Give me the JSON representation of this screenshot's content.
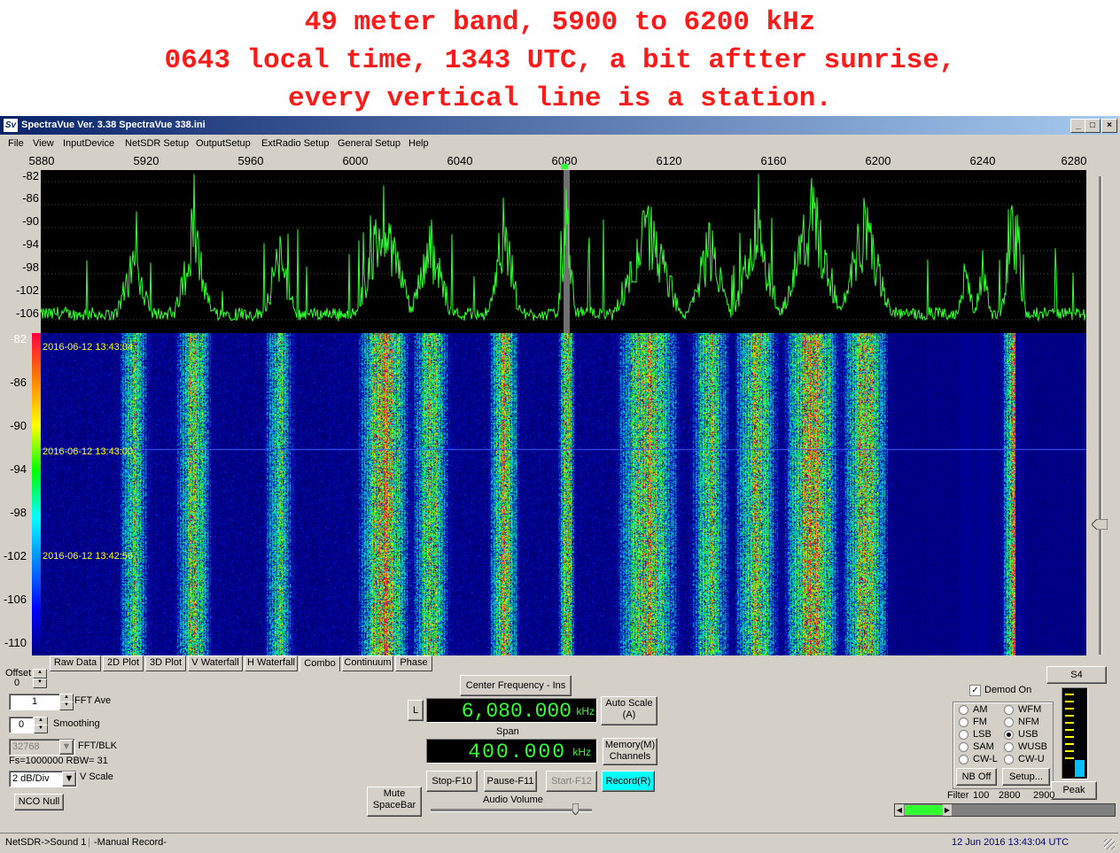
{
  "caption": {
    "line1": "49 meter band, 5900 to 6200 kHz",
    "line2": "0643 local time, 1343 UTC, a bit aftter sunrise,",
    "line3": "every vertical line is a station."
  },
  "window": {
    "title": "SpectraVue Ver. 3.38  SpectraVue 338.ini",
    "icon_text": "Sv",
    "minimize": "_",
    "maximize": "□",
    "close": "×"
  },
  "menu": [
    "File",
    "View",
    "InputDevice",
    "NetSDR Setup",
    "OutputSetup",
    "ExtRadio Setup",
    "General Setup",
    "Help"
  ],
  "freq_axis": [
    "5880",
    "5920",
    "5960",
    "6000",
    "6040",
    "6080",
    "6120",
    "6160",
    "6200",
    "6240",
    "6280"
  ],
  "spectrum_db_labels": [
    "-82",
    "-86",
    "-90",
    "-94",
    "-98",
    "-102",
    "-106"
  ],
  "waterfall_db_labels": [
    "-82",
    "-86",
    "-90",
    "-94",
    "-98",
    "-102",
    "-106",
    "-110"
  ],
  "waterfall_timestamps": [
    "2016-06-12 13:43:04",
    "2016-06-12 13:43:00",
    "2016-06-12 13:42:56"
  ],
  "tabs": [
    "Raw Data",
    "2D Plot",
    "3D Plot",
    "V Waterfall",
    "H Waterfall",
    "Combo",
    "Continuum",
    "Phase"
  ],
  "selected_tab": "Combo",
  "left_controls": {
    "offset_label": "Offset",
    "offset_value": "0",
    "fft_ave_value": "1",
    "fft_ave_label": "FFT Ave",
    "smoothing_value": "0",
    "smoothing_label": "Smoothing",
    "fft_blk_value": "32768",
    "fft_blk_label": "FFT/BLK",
    "fs_rbw": "Fs=1000000 RBW=  31",
    "vscale_value": "2 dB/Div",
    "vscale_label": "V Scale",
    "nco_null": "NCO Null"
  },
  "center": {
    "center_freq_button": "Center Frequency - Ins",
    "l_button": "L",
    "freq_value": "6,080.000",
    "freq_unit": "kHz",
    "span_label": "Span",
    "span_value": "400.000",
    "span_unit": "kHz",
    "auto_scale": "Auto Scale\n(A)",
    "memory": "Memory(M)\nChannels",
    "stop": "Stop-F10",
    "pause": "Pause-F11",
    "start": "Start-F12",
    "record": "Record(R)",
    "mute": "Mute\nSpaceBar",
    "audio_volume": "Audio Volume",
    "audio_volume_level": 0.94
  },
  "demod": {
    "demod_on_label": "Demod On",
    "demod_on_checked": true,
    "modes": [
      "AM",
      "WFM",
      "FM",
      "NFM",
      "LSB",
      "USB",
      "SAM",
      "WUSB",
      "CW-L",
      "CW-U"
    ],
    "selected_mode": "USB",
    "nb_off": "NB Off",
    "setup": "Setup...",
    "filter_label": "Filter",
    "filter_values": [
      "100",
      "2800",
      "2900"
    ],
    "s_meter": "S4",
    "s_meter_level": 0.2,
    "peak": "Peak",
    "filter_bar_fill": 0.19
  },
  "status": {
    "left": "NetSDR->Sound 1",
    "record_mode": "-Manual Record-",
    "datetime": "12 Jun 2016  13:43:04 UTC"
  },
  "colors": {
    "caption": "#ff1a1a",
    "trace": "#30ff30",
    "title_start": "#0a246a",
    "title_end": "#a6caf0",
    "window_bg": "#d4d0c8",
    "lcd_text": "#30ff30",
    "record_button": "#00ffff",
    "timestamp": "#ffff00",
    "status_datetime": "#000080"
  }
}
